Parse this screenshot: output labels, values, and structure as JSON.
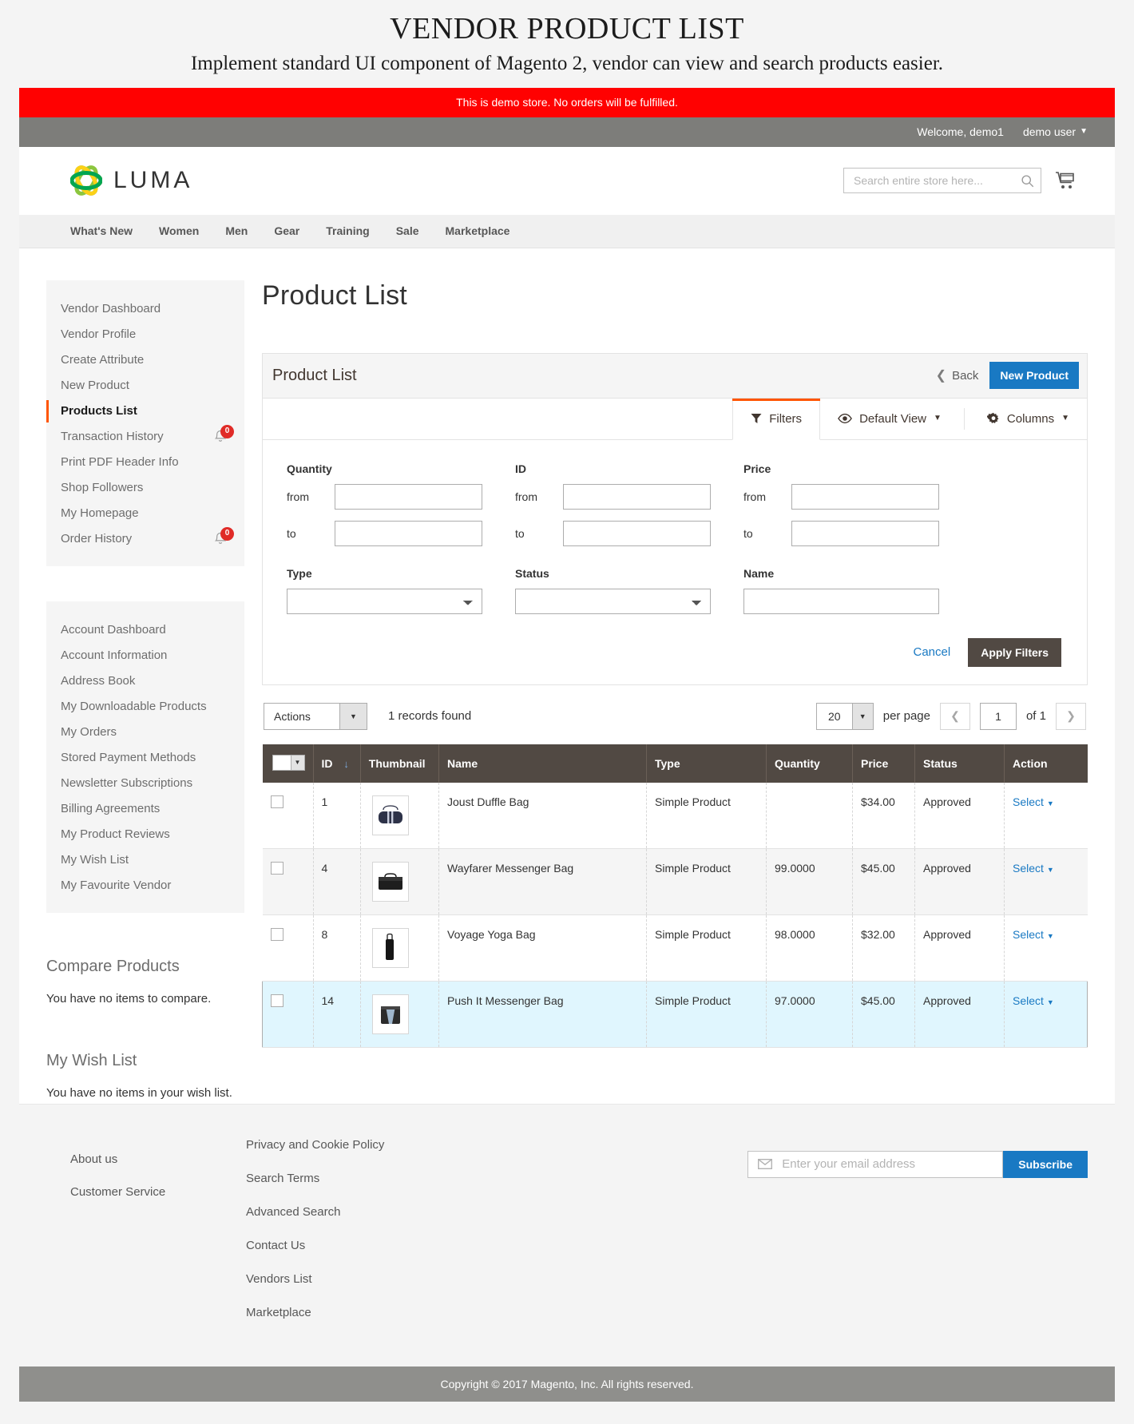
{
  "banner": {
    "title": "VENDOR PRODUCT LIST",
    "subtitle": "Implement standard UI component of Magento 2, vendor can view and search products easier."
  },
  "demo_notice": "This is demo store. No orders will be fulfilled.",
  "panel": {
    "welcome": "Welcome, demo1",
    "user": "demo user"
  },
  "header": {
    "logo_text": "LUMA",
    "search_placeholder": "Search entire store here..."
  },
  "nav": [
    {
      "label": "What's New"
    },
    {
      "label": "Women"
    },
    {
      "label": "Men"
    },
    {
      "label": "Gear"
    },
    {
      "label": "Training"
    },
    {
      "label": "Sale"
    },
    {
      "label": "Marketplace"
    }
  ],
  "sidebar": {
    "vendor_items": [
      {
        "label": "Vendor Dashboard",
        "current": false,
        "badge": null
      },
      {
        "label": "Vendor Profile",
        "current": false,
        "badge": null
      },
      {
        "label": "Create Attribute",
        "current": false,
        "badge": null
      },
      {
        "label": "New Product",
        "current": false,
        "badge": null
      },
      {
        "label": "Products List",
        "current": true,
        "badge": null
      },
      {
        "label": "Transaction History",
        "current": false,
        "badge": "0"
      },
      {
        "label": "Print PDF Header Info",
        "current": false,
        "badge": null
      },
      {
        "label": "Shop Followers",
        "current": false,
        "badge": null
      },
      {
        "label": "My Homepage",
        "current": false,
        "badge": null
      },
      {
        "label": "Order History",
        "current": false,
        "badge": "0"
      }
    ],
    "account_items": [
      {
        "label": "Account Dashboard"
      },
      {
        "label": "Account Information"
      },
      {
        "label": "Address Book"
      },
      {
        "label": "My Downloadable Products"
      },
      {
        "label": "My Orders"
      },
      {
        "label": "Stored Payment Methods"
      },
      {
        "label": "Newsletter Subscriptions"
      },
      {
        "label": "Billing Agreements"
      },
      {
        "label": "My Product Reviews"
      },
      {
        "label": "My Wish List"
      },
      {
        "label": "My Favourite Vendor"
      }
    ],
    "compare": {
      "title": "Compare Products",
      "empty": "You have no items to compare."
    },
    "wishlist": {
      "title": "My Wish List",
      "empty": "You have no items in your wish list."
    }
  },
  "main": {
    "page_title": "Product List",
    "admin_box_title": "Product List",
    "back_label": "Back",
    "new_product_label": "New Product",
    "toolbar": {
      "filters_label": "Filters",
      "view_label": "Default View",
      "columns_label": "Columns"
    },
    "filters": {
      "quantity_label": "Quantity",
      "id_label": "ID",
      "price_label": "Price",
      "from_label": "from",
      "to_label": "to",
      "type_label": "Type",
      "status_label": "Status",
      "name_label": "Name",
      "quantity_from": "",
      "quantity_to": "",
      "id_from": "",
      "id_to": "",
      "price_from": "",
      "price_to": "",
      "type_value": "",
      "status_value": "",
      "name_value": "",
      "cancel_label": "Cancel",
      "apply_label": "Apply Filters"
    },
    "grid_controls": {
      "actions_label": "Actions",
      "records_found": "1 records found",
      "per_page_value": "20",
      "per_page_label": "per page",
      "current_page": "1",
      "of_label": "of 1"
    },
    "table": {
      "columns": [
        {
          "key": "check",
          "label": ""
        },
        {
          "key": "id",
          "label": "ID"
        },
        {
          "key": "thumbnail",
          "label": "Thumbnail"
        },
        {
          "key": "name",
          "label": "Name"
        },
        {
          "key": "type",
          "label": "Type"
        },
        {
          "key": "quantity",
          "label": "Quantity"
        },
        {
          "key": "price",
          "label": "Price"
        },
        {
          "key": "status",
          "label": "Status"
        },
        {
          "key": "action",
          "label": "Action"
        }
      ],
      "sorted_by": "ID",
      "sort_dir": "asc",
      "action_label": "Select",
      "rows": [
        {
          "id": "1",
          "name": "Joust Duffle Bag",
          "type": "Simple Product",
          "quantity": "",
          "price": "$34.00",
          "status": "Approved",
          "thumb": "duffle-bag",
          "selected": false
        },
        {
          "id": "4",
          "name": "Wayfarer Messenger Bag",
          "type": "Simple Product",
          "quantity": "99.0000",
          "price": "$45.00",
          "status": "Approved",
          "thumb": "messenger-bag",
          "selected": false
        },
        {
          "id": "8",
          "name": "Voyage Yoga Bag",
          "type": "Simple Product",
          "quantity": "98.0000",
          "price": "$32.00",
          "status": "Approved",
          "thumb": "yoga-bag",
          "selected": false
        },
        {
          "id": "14",
          "name": "Push It Messenger Bag",
          "type": "Simple Product",
          "quantity": "97.0000",
          "price": "$45.00",
          "status": "Approved",
          "thumb": "push-it-bag",
          "selected": true
        }
      ]
    }
  },
  "footer": {
    "col_a": [
      {
        "label": "About us"
      },
      {
        "label": "Customer Service"
      }
    ],
    "col_b": [
      {
        "label": "Privacy and Cookie Policy"
      },
      {
        "label": "Search Terms"
      },
      {
        "label": "Advanced Search"
      },
      {
        "label": "Contact Us"
      },
      {
        "label": "Vendors List"
      },
      {
        "label": "Marketplace"
      }
    ],
    "newsletter_placeholder": "Enter your email address",
    "subscribe_label": "Subscribe",
    "copyright": "Copyright © 2017 Magento, Inc. All rights reserved."
  },
  "colors": {
    "demo_red": "#ff0101",
    "panel_gray": "#7d7d7a",
    "accent_orange": "#ff5501",
    "primary_blue": "#1979c3",
    "grid_header": "#514943",
    "selected_row": "#e0f6fe",
    "badge_red": "#e02b27"
  }
}
